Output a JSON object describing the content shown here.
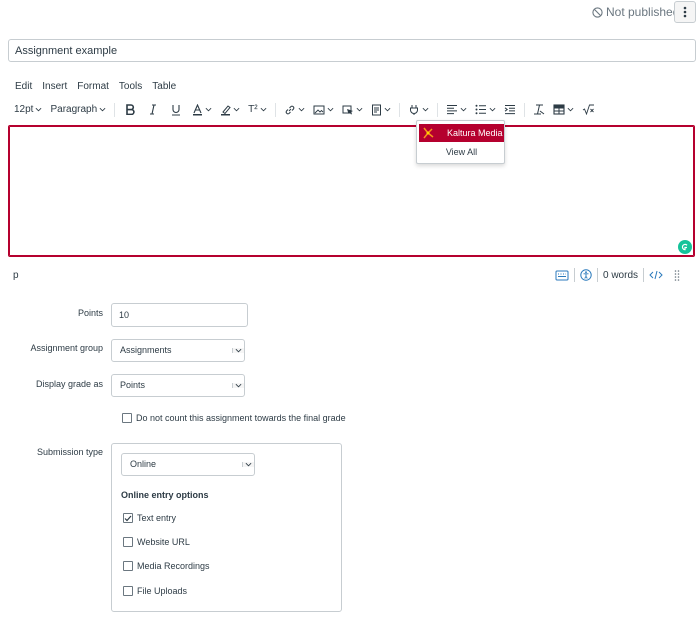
{
  "header": {
    "publish_status": "Not published"
  },
  "assignment": {
    "title": "Assignment example"
  },
  "menubar": [
    "Edit",
    "Insert",
    "Format",
    "Tools",
    "Table"
  ],
  "toolbar": {
    "font_size": "12pt",
    "block_format": "Paragraph",
    "superscript": "T²"
  },
  "media_dropdown": {
    "selected": "Kaltura Media",
    "other": "View All"
  },
  "status": {
    "path": "p",
    "word_count": "0 words"
  },
  "form": {
    "points_label": "Points",
    "points_value": "10",
    "group_label": "Assignment group",
    "group_value": "Assignments",
    "display_label": "Display grade as",
    "display_value": "Points",
    "exclude_label": "Do not count this assignment towards the final grade",
    "submission_label": "Submission type",
    "submission_value": "Online",
    "entry_heading": "Online entry options",
    "entry_options": [
      {
        "label": "Text entry",
        "checked": true
      },
      {
        "label": "Website URL",
        "checked": false
      },
      {
        "label": "Media Recordings",
        "checked": false
      },
      {
        "label": "File Uploads",
        "checked": false
      }
    ]
  },
  "colors": {
    "accent": "#b5002e",
    "text": "#2d3b45",
    "border": "#c7cdd1",
    "grammarly": "#15c39a"
  }
}
